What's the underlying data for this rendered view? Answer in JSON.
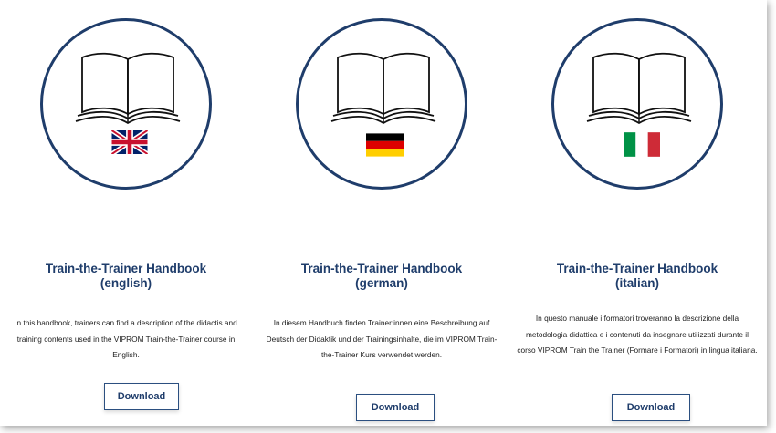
{
  "cards": [
    {
      "title_line1": "Train-the-Trainer Handbook",
      "title_line2": "(english)",
      "description": "In this handbook, trainers can find a description of the didactis and training contents used in the VIPROM Train-the-Trainer course in English.",
      "button_label": "Download",
      "flag_icon": "uk-flag-icon"
    },
    {
      "title_line1": "Train-the-Trainer Handbook",
      "title_line2": "(german)",
      "description": "In diesem Handbuch finden Trainer:innen eine Beschreibung auf Deutsch der Didaktik und der Trainingsinhalte, die im VIPROM Train-the-Trainer Kurs verwendet werden.",
      "button_label": "Download",
      "flag_icon": "germany-flag-icon"
    },
    {
      "title_line1": "Train-the-Trainer Handbook",
      "title_line2": "(italian)",
      "description": "In questo manuale i formatori troveranno la descrizione della metodologia didattica e i contenuti da insegnare utilizzati durante il corso VIPROM Train the Trainer (Formare i Formatori) in lingua italiana.",
      "button_label": "Download",
      "flag_icon": "italy-flag-icon"
    }
  ],
  "colors": {
    "accent": "#1f3d6b",
    "button_border": "#2b4f80"
  }
}
